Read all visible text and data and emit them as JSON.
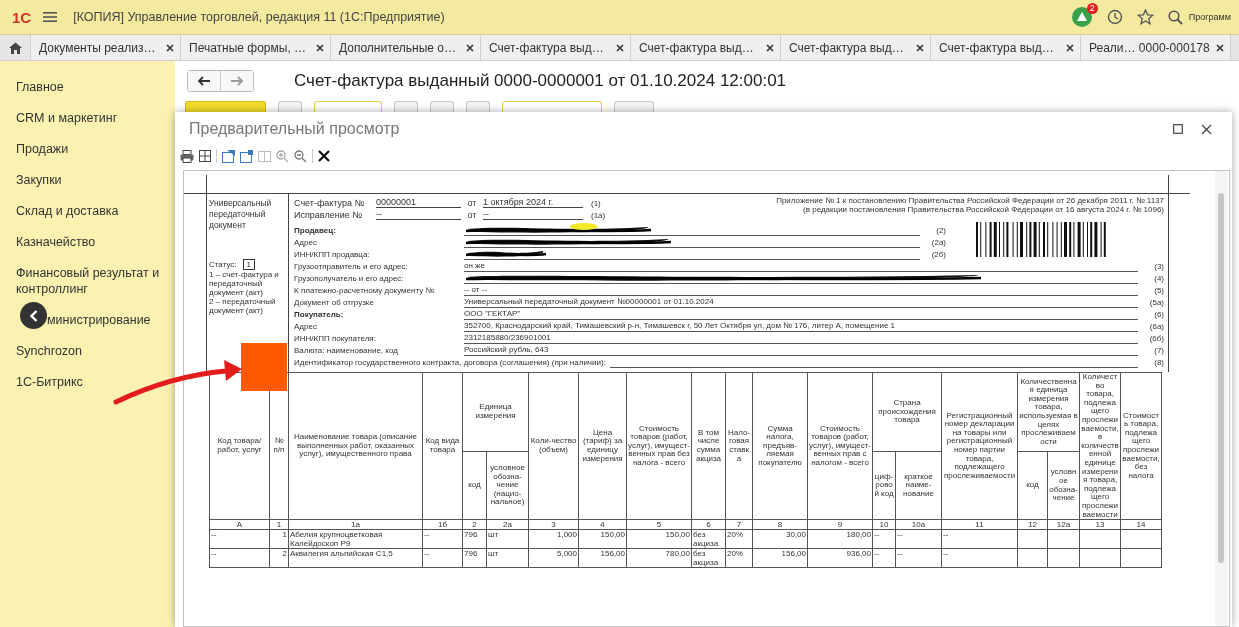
{
  "app": {
    "logo": "1С",
    "title": "[КОПИЯ] Управление торговлей, редакция 11  (1С:Предприятие)",
    "notifications": "2",
    "search_label": "Программ"
  },
  "tabs": [
    {
      "label": "Документы реализ…",
      "selected": false
    },
    {
      "label": "Печатные формы, …",
      "selected": false
    },
    {
      "label": "Дополнительные о…",
      "selected": false
    },
    {
      "label": "Счет-фактура выд…",
      "selected": false
    },
    {
      "label": "Счет-фактура выд…",
      "selected": false
    },
    {
      "label": "Счет-фактура выд…",
      "selected": false
    },
    {
      "label": "Счет-фактура выд…",
      "selected": false
    },
    {
      "label": "Реали… 0000-000178",
      "selected": false
    }
  ],
  "sidebar": {
    "items": [
      {
        "label": "Главное",
        "covered": false
      },
      {
        "label": "CRM и маркетинг",
        "covered": false
      },
      {
        "label": "Продажи",
        "covered": false
      },
      {
        "label": "Закупки",
        "covered": false
      },
      {
        "label": "Склад и доставка",
        "covered": false
      },
      {
        "label": "Казначейство",
        "covered": false
      },
      {
        "label": "Финансовый результат и контроллинг",
        "covered": false
      },
      {
        "label": "министрирование",
        "covered": true
      },
      {
        "label": "Synchrozon",
        "covered": false
      },
      {
        "label": "1С-Битрикс",
        "covered": false
      }
    ]
  },
  "document": {
    "title": "Счет-фактура выданный 0000-0000001 от 01.10.2024 12:00:01"
  },
  "preview": {
    "title": "Предварительный просмотр"
  },
  "invoice": {
    "doc_type": "Универсальный передаточный документ",
    "status_label": "Статус:",
    "status": "1",
    "status_legend": [
      "1 – счет-фактура и передаточный документ (акт)",
      "2 – передаточный документ (акт)"
    ],
    "number_rows": [
      {
        "label": "Счет-фактура №",
        "number": "00000001",
        "date_label": "от",
        "date": "1 октября 2024 г.",
        "code": "(1)"
      },
      {
        "label": "Исправление №",
        "number": "--",
        "date_label": "от",
        "date": "--",
        "code": "(1а)"
      }
    ],
    "notice": [
      "Приложение № 1 к постановлению Правительства Российской Федерации от 26 декабря 2011 г. № 1137",
      "(в редакции постановления Правительства Российской Федерации от 16 августа 2024 г. № 1096)"
    ],
    "fields": [
      {
        "label": "Продавец:",
        "bold": true,
        "redacted": true,
        "highlighted": true,
        "beside_barcode": true,
        "code": "(2)"
      },
      {
        "label": "Адрес",
        "bold": false,
        "redacted": true,
        "highlighted": false,
        "beside_barcode": true,
        "code": "(2а)"
      },
      {
        "label": "ИНН/КПП продавца:",
        "bold": false,
        "redacted": true,
        "highlighted": false,
        "beside_barcode": true,
        "code": "(2б)"
      },
      {
        "label": "Грузоотправитель и его адрес:",
        "bold": false,
        "redacted": false,
        "highlighted": false,
        "beside_barcode": false,
        "value": "он же",
        "code": "(3)"
      },
      {
        "label": "Грузополучатель и его адрес:",
        "bold": false,
        "redacted": true,
        "highlighted": false,
        "beside_barcode": false,
        "code": "(4)"
      },
      {
        "label": "К платежно-расчетному документу №",
        "bold": false,
        "redacted": false,
        "highlighted": false,
        "beside_barcode": false,
        "value": "-- от --",
        "code": "(5)"
      },
      {
        "label": "Документ об отгрузке",
        "bold": false,
        "redacted": false,
        "highlighted": false,
        "beside_barcode": false,
        "value": "Универсальный передаточный документ №00000001 от 01.10.2024",
        "code": "(5а)"
      },
      {
        "label": "Покупатель:",
        "bold": true,
        "redacted": false,
        "highlighted": false,
        "beside_barcode": false,
        "value": "ООО \"ГЕКТАР\"",
        "code": "(6)"
      },
      {
        "label": "Адрес",
        "bold": false,
        "redacted": false,
        "highlighted": false,
        "beside_barcode": false,
        "value": "352700, Краснодарский край, Тимашевский р-н, Тимашевск г, 50 Лет Октября ул, дом № 176, литер А, помещение 1",
        "code": "(6а)"
      },
      {
        "label": "ИНН/КПП покупателя:",
        "bold": false,
        "redacted": false,
        "highlighted": false,
        "beside_barcode": false,
        "value": "2312185880/236901001",
        "code": "(6б)"
      },
      {
        "label": "Валюта: наименование, код",
        "bold": false,
        "redacted": false,
        "highlighted": false,
        "beside_barcode": false,
        "value": "Российский рубль, 643",
        "code": "(7)"
      },
      {
        "label": "Идентификатор государственного контракта, договора (соглашения) (при наличии):",
        "bold": false,
        "redacted": false,
        "highlighted": false,
        "beside_barcode": false,
        "code": "(8)"
      }
    ],
    "table": {
      "columns": [
        {
          "kind": "single",
          "label": "Код товара/ работ, услуг"
        },
        {
          "kind": "single",
          "label": "№ п/п"
        },
        {
          "kind": "single",
          "label": "Наименование товара (описание выполненных работ, оказанных услуг), имущественного права"
        },
        {
          "kind": "single",
          "label": "Код вида товара"
        },
        {
          "kind": "group",
          "label": "Единица измерения",
          "colspan": 2,
          "columns": [
            {
              "label": "код"
            },
            {
              "label": "условное обозна-чение (нацио-нальное)"
            }
          ]
        },
        {
          "kind": "single",
          "label": "Коли-чество (объем)"
        },
        {
          "kind": "single",
          "label": "Цена (тариф) за единицу измерения"
        },
        {
          "kind": "single",
          "label": "Стоимость товаров (работ, услуг), имущест-венных прав без налога - всего"
        },
        {
          "kind": "single",
          "label": "В том числе сумма акциза"
        },
        {
          "kind": "single",
          "label": "Нало-говая ставка"
        },
        {
          "kind": "single",
          "label": "Сумма налога, предъяв-ляемая покупателю"
        },
        {
          "kind": "single",
          "label": "Стоимость товаров (работ, услуг), имущест-венных прав с налогом - всего"
        },
        {
          "kind": "group",
          "label": "Страна происхождения товара",
          "colspan": 2,
          "columns": [
            {
              "label": "циф-ровой код"
            },
            {
              "label": "краткое наиме-нование"
            }
          ]
        },
        {
          "kind": "single",
          "label": "Регистрационный номер декларации на товары или регистрационный номер партии товара, подлежащего прослеживаемости"
        },
        {
          "kind": "group",
          "label": "Количественная единица измерения товара, используемая в целях прослеживаемости",
          "colspan": 2,
          "columns": [
            {
              "label": "код"
            },
            {
              "label": "условное обозна-чение"
            }
          ]
        },
        {
          "kind": "single",
          "label": "Количество товара, подлежащего прослеживаемости, в количественной единице измерения товара, подлежащего прослеживаемости"
        },
        {
          "kind": "single",
          "label": "Стоимость товара, подлежащего прослеживаемости, без налога"
        }
      ],
      "number_row": [
        "А",
        "1",
        "1а",
        "1б",
        "2",
        "2а",
        "3",
        "4",
        "5",
        "6",
        "7",
        "8",
        "9",
        "10",
        "10а",
        "11",
        "12",
        "12а",
        "13",
        "14"
      ],
      "rows": [
        {
          "cells": [
            "--",
            "1",
            "Абелия крупноцветковая Калейдоскоп Р9",
            "--",
            "796",
            "шт",
            "1,000",
            "150,00",
            "150,00",
            "без акциза",
            "20%",
            "30,00",
            "180,00",
            "--",
            "--",
            "--"
          ]
        },
        {
          "cells": [
            "--",
            "2",
            "Аквилегия альпийская С1,5",
            "--",
            "796",
            "шт",
            "5,000",
            "156,00",
            "780,00",
            "без акциза",
            "20%",
            "156,00",
            "936,00",
            "--",
            "--",
            "--"
          ]
        }
      ]
    }
  }
}
